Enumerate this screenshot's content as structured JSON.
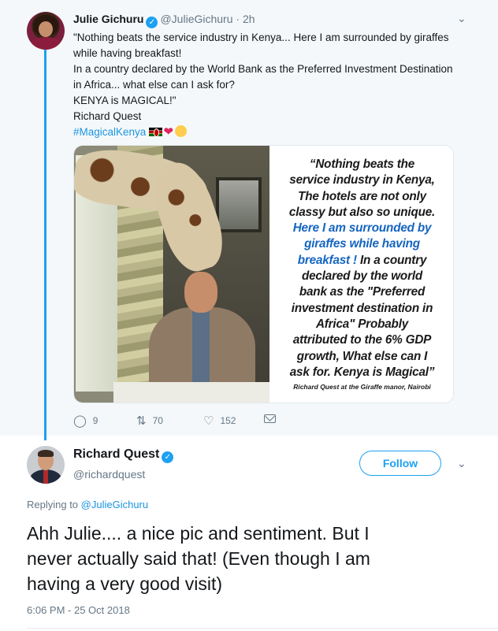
{
  "parent_tweet": {
    "author_name": "Julie Gichuru",
    "handle": "@JulieGichuru",
    "time": "· 2h",
    "text_lines": [
      "\"Nothing beats the service industry in Kenya... Here I am surrounded by giraffes",
      "while having breakfast!",
      "In a country declared by the World Bank as the Preferred Investment Destination",
      "in Africa... what else can I ask for?",
      "KENYA is MAGICAL!\"",
      "Richard Quest"
    ],
    "hashtag": "#MagicalKenya",
    "image_quote": {
      "lines": [
        "“Nothing beats the",
        "service industry in Kenya,",
        "The hotels are not only",
        "classy but also so unique."
      ],
      "highlight_lines": [
        "Here I am surrounded by",
        "giraffes while having",
        "breakfast !"
      ],
      "highlight_tail": " In a country",
      "rest_lines": [
        "declared by the world",
        "bank as the \"Preferred",
        "investment destination in",
        "Africa\" Probably",
        "attributed to the 6% GDP",
        "growth, What else can I",
        "ask for. Kenya is Magical”"
      ],
      "credit": "Richard Quest at the Giraffe manor, Nairobi"
    },
    "actions": {
      "replies": "9",
      "retweets": "70",
      "likes": "152"
    }
  },
  "main_tweet": {
    "author_name": "Richard Quest",
    "handle": "@richardquest",
    "follow_label": "Follow",
    "replying_prefix": "Replying to ",
    "replying_to": "@JulieGichuru",
    "text_lines": [
      "Ahh Julie.... a nice pic and sentiment. But I",
      "never actually said that! (Even though I am",
      "having a very good visit)"
    ],
    "timestamp": "6:06 PM - 25 Oct 2018"
  },
  "icons": {
    "verified": "verified-badge-icon",
    "chevron": "chevron-down-icon",
    "reply": "reply-icon",
    "retweet": "retweet-icon",
    "like": "heart-icon",
    "message": "envelope-icon"
  },
  "colors": {
    "accent": "#1da1f2",
    "link": "#1b95e0",
    "secondary_text": "#657786",
    "parent_bg": "#f5f8fa"
  }
}
